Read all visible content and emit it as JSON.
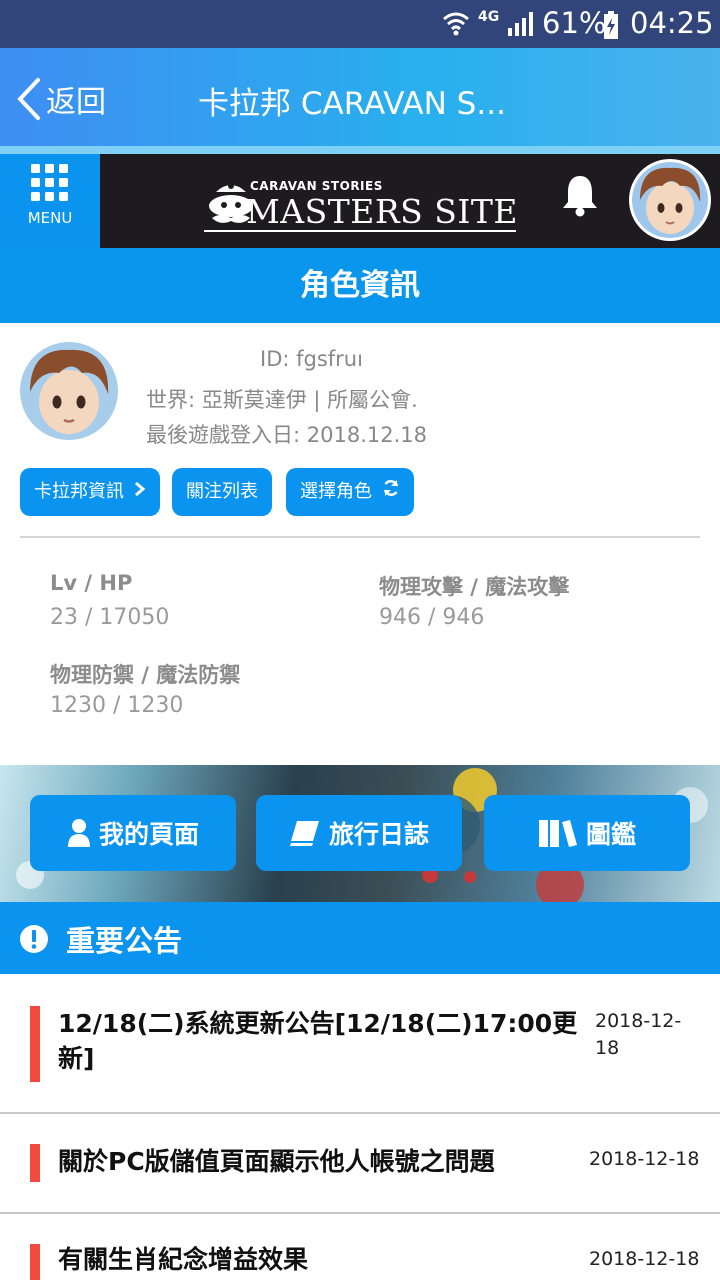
{
  "status_bar": {
    "network": "4G",
    "battery": "61%",
    "time": "04:25",
    "icons": [
      "wifi-icon",
      "signal-icon",
      "battery-charging-icon"
    ]
  },
  "header": {
    "back_label": "返回",
    "title": "卡拉邦 CARAVAN S..."
  },
  "site_nav": {
    "menu_label": "MENU",
    "logo_small": "CARAVAN STORIES",
    "logo_big": "MASTERS SITE",
    "icons": [
      "menu-grid-icon",
      "bell-icon",
      "avatar"
    ]
  },
  "section_title": "角色資訊",
  "profile": {
    "id": "ID: fgsfruı",
    "world": "世界: 亞斯莫達伊  | 所屬公會.",
    "last_login": "最後遊戲登入日: 2018.12.18",
    "buttons": {
      "caravan_info": "卡拉邦資訊",
      "follow_list": "關注列表",
      "select_character": "選擇角色"
    }
  },
  "stats": {
    "lv_hp_label": "Lv / HP",
    "lv_hp_value": "23 / 17050",
    "attack_label": "物理攻擊 / 魔法攻擊",
    "attack_value": "946 / 946",
    "defense_label": "物理防禦 / 魔法防禦",
    "defense_value": "1230 / 1230"
  },
  "quick_links": {
    "my_page": "我的頁面",
    "travel_log": "旅行日誌",
    "encyclopedia": "圖鑑"
  },
  "notices": {
    "title": "重要公告",
    "items": [
      {
        "title": "12/18(二)系統更新公告[12/18(二)17:00更新]",
        "date": "2018-12-18"
      },
      {
        "title": "關於PC版儲值頁面顯示他人帳號之問題",
        "date": "2018-12-18"
      },
      {
        "title": "有關生肖紀念增益效果",
        "date": "2018-12-18"
      }
    ]
  },
  "colors": {
    "accent": "#0a93ef",
    "status_bar": "#31457a",
    "nav_bg": "#1d1b20",
    "notice_marker": "#f04b3e"
  }
}
